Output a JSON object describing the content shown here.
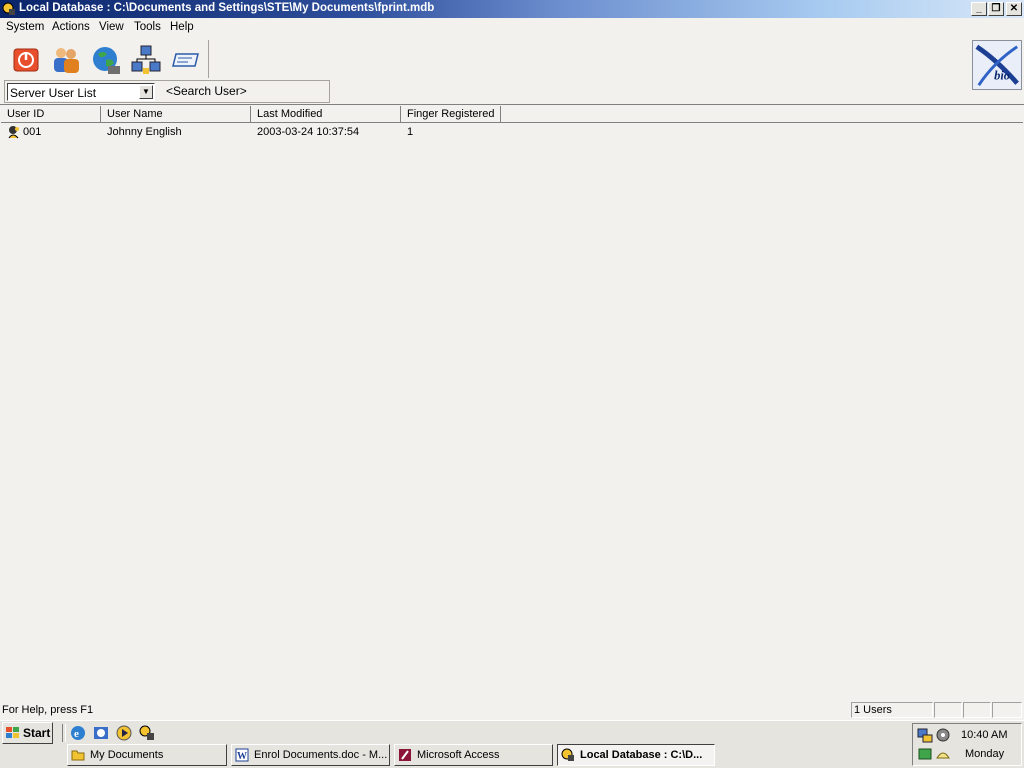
{
  "window": {
    "title": "Local Database : C:\\Documents and Settings\\STE\\My Documents\\fprint.mdb",
    "caption_buttons": [
      "minimize",
      "restore",
      "close"
    ]
  },
  "menu": {
    "items": [
      "System",
      "Actions",
      "View",
      "Tools",
      "Help"
    ]
  },
  "toolbar": {
    "buttons": [
      "power-icon",
      "users-icon",
      "globe-icon",
      "network-icon",
      "card-reader-icon"
    ],
    "logo_text": "bio"
  },
  "filter": {
    "selected": "Server User List",
    "search_placeholder": "<Search User>"
  },
  "list": {
    "columns": [
      "User ID",
      "User Name",
      "Last Modified",
      "Finger Registered"
    ],
    "rows": [
      {
        "user_id": "001",
        "user_name": "Johnny English",
        "last_modified": "2003-03-24 10:37:54",
        "finger_registered": "1"
      }
    ]
  },
  "statusbar": {
    "help_text": "For Help, press F1",
    "users_count": "1 Users"
  },
  "taskbar": {
    "start_label": "Start",
    "quick_launch": [
      "ie-icon",
      "outlook-icon",
      "media-player-icon",
      "app-icon"
    ],
    "tasks": [
      {
        "label": "My Documents",
        "icon": "folder-icon",
        "active": false
      },
      {
        "label": "Enrol Documents.doc - M...",
        "icon": "word-icon",
        "active": false
      },
      {
        "label": "Microsoft Access",
        "icon": "access-icon",
        "active": false
      },
      {
        "label": "Local Database : C:\\D...",
        "icon": "fingerprint-app-icon",
        "active": true
      }
    ],
    "clock": "10:40 AM",
    "day": "Monday"
  },
  "colors": {
    "title_active": "#0a246a",
    "face": "#f2f1ee"
  }
}
